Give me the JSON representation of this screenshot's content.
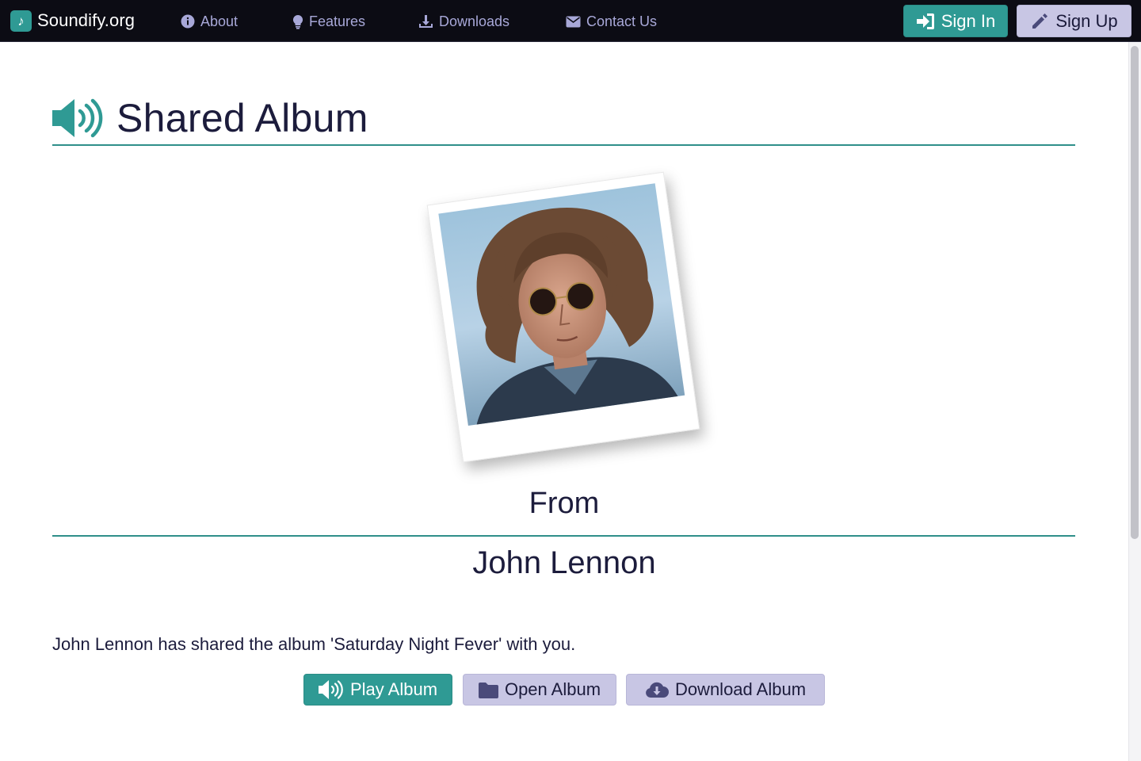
{
  "navbar": {
    "brand": "Soundify.org",
    "links": [
      {
        "label": "About",
        "icon": "info-icon"
      },
      {
        "label": "Features",
        "icon": "lightbulb-icon"
      },
      {
        "label": "Downloads",
        "icon": "download-icon"
      },
      {
        "label": "Contact Us",
        "icon": "envelope-icon"
      }
    ],
    "sign_in": "Sign In",
    "sign_up": "Sign Up"
  },
  "page": {
    "title": "Shared Album",
    "from_label": "From",
    "sender_name": "John Lennon",
    "message": "John Lennon has shared the album 'Saturday Night Fever' with you."
  },
  "actions": {
    "play": "Play Album",
    "open": "Open Album",
    "download": "Download Album"
  },
  "colors": {
    "accent": "#2f9a94",
    "secondary": "#c8c6e4",
    "navbar": "#0c0c14",
    "nav_link": "#a8a8d8"
  }
}
